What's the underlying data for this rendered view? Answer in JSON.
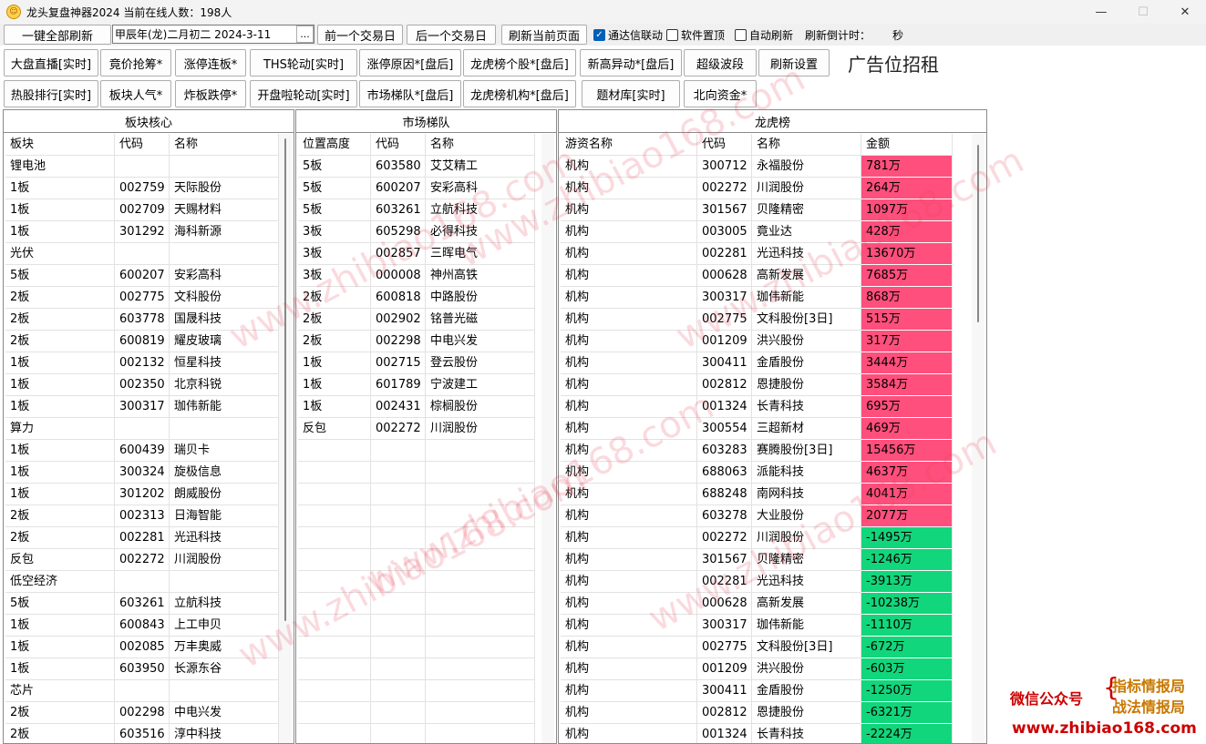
{
  "window": {
    "title": "龙头复盘神器2024 当前在线人数：198人",
    "minimize": "—",
    "maximize": "☐",
    "close": "✕"
  },
  "toolbar": {
    "refresh_all": "一键全部刷新",
    "date_value": "甲辰年(龙)二月初二  2024-3-11",
    "date_picker": "...",
    "prev_day": "前一个交易日",
    "next_day": "后一个交易日",
    "refresh_page": "刷新当前页面",
    "tdx_link": "通达信联动",
    "tdx_link_checked": true,
    "pin_top": "软件置顶",
    "pin_top_checked": false,
    "auto_refresh": "自动刷新",
    "auto_refresh_checked": false,
    "countdown_label": "刷新倒计时：",
    "countdown_unit": "秒"
  },
  "nav_row1": [
    "大盘直播[实时]",
    "竟价抢筹*",
    "涨停连板*",
    "THS轮动[实时]",
    "涨停原因*[盘后]",
    "龙虎榜个股*[盘后]",
    "新高异动*[盘后]",
    "超级波段",
    "刷新设置"
  ],
  "nav_row2": [
    "热股排行[实时]",
    "板块人气*",
    "炸板跌停*",
    "开盘啦轮动[实时]",
    "市场梯队*[盘后]",
    "龙虎榜机构*[盘后]",
    "题材库[实时]",
    "北向资金*"
  ],
  "ad_text": "广告位招租",
  "panel_sector": {
    "title": "板块核心",
    "headers": [
      "板块",
      "代码",
      "名称"
    ],
    "rows": [
      [
        "锂电池",
        "",
        ""
      ],
      [
        "1板",
        "002759",
        "天际股份"
      ],
      [
        "1板",
        "002709",
        "天赐材料"
      ],
      [
        "1板",
        "301292",
        "海科新源"
      ],
      [
        "光伏",
        "",
        ""
      ],
      [
        "5板",
        "600207",
        "安彩高科"
      ],
      [
        "2板",
        "002775",
        "文科股份"
      ],
      [
        "2板",
        "603778",
        "国晟科技"
      ],
      [
        "2板",
        "600819",
        "耀皮玻璃"
      ],
      [
        "1板",
        "002132",
        "恒星科技"
      ],
      [
        "1板",
        "002350",
        "北京科锐"
      ],
      [
        "1板",
        "300317",
        "珈伟新能"
      ],
      [
        "算力",
        "",
        ""
      ],
      [
        "1板",
        "600439",
        "瑞贝卡"
      ],
      [
        "1板",
        "300324",
        "旋极信息"
      ],
      [
        "1板",
        "301202",
        "朗威股份"
      ],
      [
        "2板",
        "002313",
        "日海智能"
      ],
      [
        "2板",
        "002281",
        "光迅科技"
      ],
      [
        "反包",
        "002272",
        "川润股份"
      ],
      [
        "低空经济",
        "",
        ""
      ],
      [
        "5板",
        "603261",
        "立航科技"
      ],
      [
        "1板",
        "600843",
        "上工申贝"
      ],
      [
        "1板",
        "002085",
        "万丰奥威"
      ],
      [
        "1板",
        "603950",
        "长源东谷"
      ],
      [
        "芯片",
        "",
        ""
      ],
      [
        "2板",
        "002298",
        "中电兴发"
      ],
      [
        "2板",
        "603516",
        "淳中科技"
      ]
    ]
  },
  "panel_ladder": {
    "title": "市场梯队",
    "headers": [
      "位置高度",
      "代码",
      "名称"
    ],
    "rows": [
      [
        "5板",
        "603580",
        "艾艾精工"
      ],
      [
        "5板",
        "600207",
        "安彩高科"
      ],
      [
        "5板",
        "603261",
        "立航科技"
      ],
      [
        "3板",
        "605298",
        "必得科技"
      ],
      [
        "3板",
        "002857",
        "三晖电气"
      ],
      [
        "3板",
        "000008",
        "神州高铁"
      ],
      [
        "2板",
        "600818",
        "中路股份"
      ],
      [
        "2板",
        "002902",
        "铭普光磁"
      ],
      [
        "2板",
        "002298",
        "中电兴发"
      ],
      [
        "1板",
        "002715",
        "登云股份"
      ],
      [
        "1板",
        "601789",
        "宁波建工"
      ],
      [
        "1板",
        "002431",
        "棕榈股份"
      ],
      [
        "反包",
        "002272",
        "川润股份"
      ]
    ]
  },
  "panel_lhb": {
    "title": "龙虎榜",
    "headers": [
      "游资名称",
      "代码",
      "名称",
      "金额"
    ],
    "pos_color": "#ff4f7c",
    "neg_color": "#12d67b",
    "rows": [
      [
        "机构",
        "300712",
        "永福股份",
        "781万",
        "pos"
      ],
      [
        "机构",
        "002272",
        "川润股份",
        "264万",
        "pos"
      ],
      [
        "机构",
        "301567",
        "贝隆精密",
        "1097万",
        "pos"
      ],
      [
        "机构",
        "003005",
        "竟业达",
        "428万",
        "pos"
      ],
      [
        "机构",
        "002281",
        "光迅科技",
        "13670万",
        "pos"
      ],
      [
        "机构",
        "000628",
        "高新发展",
        "7685万",
        "pos"
      ],
      [
        "机构",
        "300317",
        "珈伟新能",
        "868万",
        "pos"
      ],
      [
        "机构",
        "002775",
        "文科股份[3日]",
        "515万",
        "pos"
      ],
      [
        "机构",
        "001209",
        "洪兴股份",
        "317万",
        "pos"
      ],
      [
        "机构",
        "300411",
        "金盾股份",
        "3444万",
        "pos"
      ],
      [
        "机构",
        "002812",
        "恩捷股份",
        "3584万",
        "pos"
      ],
      [
        "机构",
        "001324",
        "长青科技",
        "695万",
        "pos"
      ],
      [
        "机构",
        "300554",
        "三超新材",
        "469万",
        "pos"
      ],
      [
        "机构",
        "603283",
        "赛腾股份[3日]",
        "15456万",
        "pos"
      ],
      [
        "机构",
        "688063",
        "派能科技",
        "4637万",
        "pos"
      ],
      [
        "机构",
        "688248",
        "南网科技",
        "4041万",
        "pos"
      ],
      [
        "机构",
        "603278",
        "大业股份",
        "2077万",
        "pos"
      ],
      [
        "机构",
        "002272",
        "川润股份",
        "-1495万",
        "neg"
      ],
      [
        "机构",
        "301567",
        "贝隆精密",
        "-1246万",
        "neg"
      ],
      [
        "机构",
        "002281",
        "光迅科技",
        "-3913万",
        "neg"
      ],
      [
        "机构",
        "000628",
        "高新发展",
        "-10238万",
        "neg"
      ],
      [
        "机构",
        "300317",
        "珈伟新能",
        "-1110万",
        "neg"
      ],
      [
        "机构",
        "002775",
        "文科股份[3日]",
        "-672万",
        "neg"
      ],
      [
        "机构",
        "001209",
        "洪兴股份",
        "-603万",
        "neg"
      ],
      [
        "机构",
        "300411",
        "金盾股份",
        "-1250万",
        "neg"
      ],
      [
        "机构",
        "002812",
        "恩捷股份",
        "-6321万",
        "neg"
      ],
      [
        "机构",
        "001324",
        "长青科技",
        "-2224万",
        "neg"
      ]
    ]
  },
  "watermark": "www.zhibiao168.com",
  "brand": {
    "wechat": "微信公众号",
    "brace": "{",
    "line1": "指标情报局",
    "line2": "战法情报局",
    "url": "www.zhibiao168.com"
  }
}
